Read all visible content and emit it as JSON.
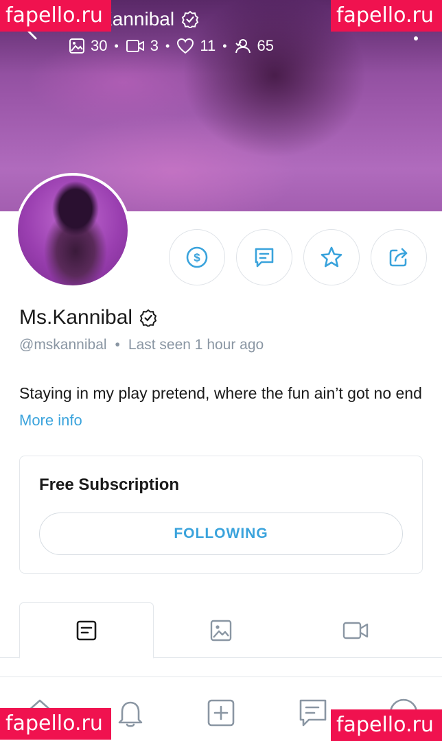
{
  "header": {
    "title": "Ms.Kannibal",
    "stats": {
      "photos": "30",
      "videos": "3",
      "likes": "11",
      "fans": "65"
    }
  },
  "profile": {
    "name": "Ms.Kannibal",
    "handle": "@mskannibal",
    "separator": "•",
    "last_seen": "Last seen 1 hour ago",
    "bio": "Staying in my play pretend, where the fun ain’t got no end",
    "more_info": "More info"
  },
  "subscription": {
    "title": "Free Subscription",
    "button_label": "FOLLOWING"
  },
  "watermark": "fapello.ru",
  "colors": {
    "accent": "#3aa3dc",
    "muted": "#8a96a3",
    "border": "#e3e7eb",
    "watermark_bg": "#f0124f"
  },
  "icons": {
    "back": "arrow-left-icon",
    "menu": "more-vertical-icon",
    "tip": "dollar-icon",
    "message": "message-icon",
    "favorite": "star-icon",
    "share": "share-icon",
    "verified": "verified-badge-icon"
  }
}
